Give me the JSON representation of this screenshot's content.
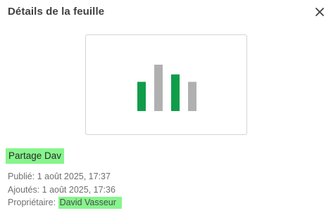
{
  "panel": {
    "title": "Détails de la feuille"
  },
  "icons": {
    "close": "close-icon",
    "thumbnail": "bar-chart-thumbnail-icon"
  },
  "thumbnail": {
    "bars": [
      {
        "level": 0.63,
        "color": "#0f9d4a"
      },
      {
        "level": 1.0,
        "color": "#b0b0b0"
      },
      {
        "level": 0.79,
        "color": "#0f9d4a"
      },
      {
        "level": 0.63,
        "color": "#b0b0b0"
      }
    ]
  },
  "sheet": {
    "name": "Partage Dav",
    "published": "Publié: 1 août 2025, 17:37",
    "added": "Ajoutés: 1 août 2025, 17:36",
    "owner_label": "Propriétaire: ",
    "owner_name": "David Vasseur"
  },
  "colors": {
    "highlight": "#86f58c",
    "accent_green": "#0f9d4a",
    "neutral_bar": "#b0b0b0"
  }
}
